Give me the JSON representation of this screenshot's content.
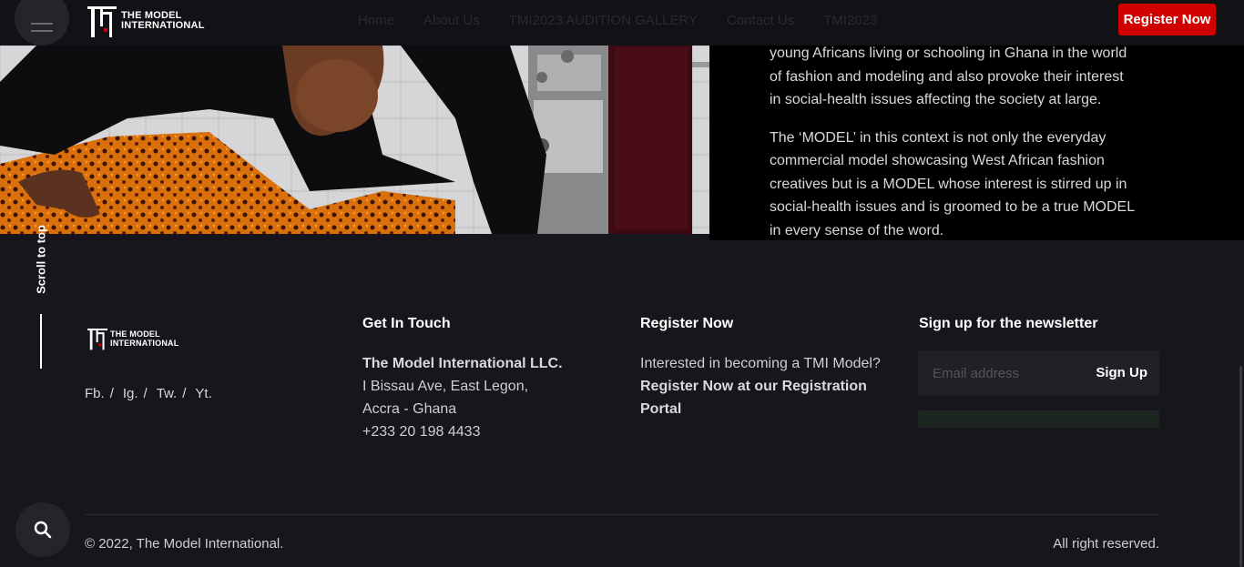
{
  "header": {
    "logo_line1": "THE MODEL",
    "logo_line2": "INTERNATIONAL",
    "nav": [
      "Home",
      "About Us",
      "TMI2023 AUDITION GALLERY",
      "Contact Us",
      "TMI2023"
    ],
    "register_label": "Register Now"
  },
  "hero": {
    "paragraph1": "young Africans living or schooling in Ghana  in the world of fashion and modeling and also provoke their interest in social-health issues affecting the society at large.",
    "paragraph2": "The ‘MODEL’ in this context is not only the everyday commercial model showcasing West African fashion creatives but is a MODEL whose interest is stirred up in social-health issues and is groomed to be a true MODEL in every sense of the word."
  },
  "scroll_top_label": "Scroll to top",
  "footer": {
    "logo_line1": "THE MODEL",
    "logo_line2": "INTERNATIONAL",
    "socials": [
      "Fb.",
      "Ig.",
      "Tw.",
      "Yt."
    ],
    "contact": {
      "title": "Get In Touch",
      "company": "The Model International LLC.",
      "address1": "I Bissau Ave, East Legon,",
      "address2": "Accra - Ghana",
      "phone": "+233 20 198 4433"
    },
    "register": {
      "title": "Register Now",
      "text": "Interested in becoming a TMI Model?",
      "link_line1": "Register Now at our Registration",
      "link_line2": "Portal"
    },
    "newsletter": {
      "title": "Sign up for the newsletter",
      "placeholder": "Email address",
      "button": "Sign Up"
    },
    "copyright": "© 2022, The Model International.",
    "rights": "All right reserved."
  },
  "icons": {
    "menu": "hamburger-icon",
    "search": "search-icon",
    "logo": "tmi-logo-icon"
  },
  "colors": {
    "accent": "#d10000",
    "background": "#17161c",
    "header": "#121116"
  }
}
